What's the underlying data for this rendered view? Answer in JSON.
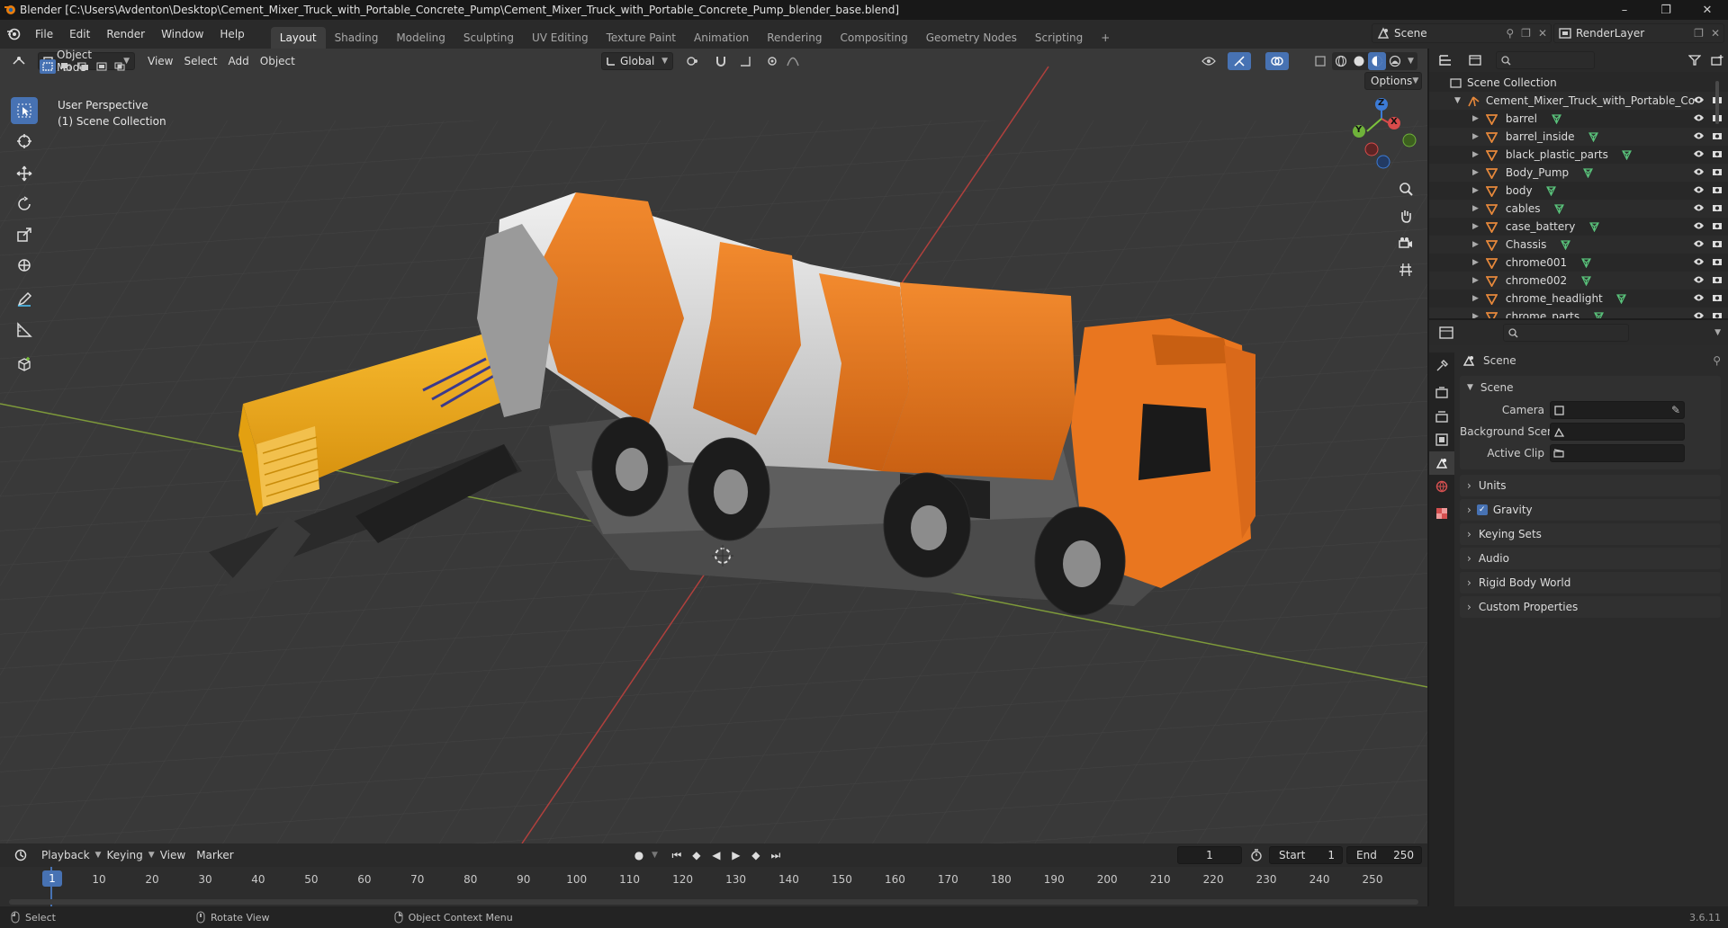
{
  "window": {
    "title": "Blender [C:\\Users\\Avdenton\\Desktop\\Cement_Mixer_Truck_with_Portable_Concrete_Pump\\Cement_Mixer_Truck_with_Portable_Concrete_Pump_blender_base.blend]",
    "controls": [
      "–",
      "❐",
      "✕"
    ]
  },
  "menu": [
    "File",
    "Edit",
    "Render",
    "Window",
    "Help"
  ],
  "workspaces": [
    "Layout",
    "Shading",
    "Modeling",
    "Sculpting",
    "UV Editing",
    "Texture Paint",
    "Animation",
    "Rendering",
    "Compositing",
    "Geometry Nodes",
    "Scripting"
  ],
  "add_workspace": "+",
  "scene_name": "Scene",
  "render_layer": "RenderLayer",
  "viewport": {
    "mode": "Object Mode",
    "menus": [
      "View",
      "Select",
      "Add",
      "Object"
    ],
    "orientation": "Global",
    "options_label": "Options",
    "perspective_label": "User Perspective",
    "collection_label": "(1) Scene Collection",
    "gizmo": {
      "x": "X",
      "y": "Y",
      "z": "Z"
    }
  },
  "outliner": {
    "root": "Scene Collection",
    "collection": "Cement_Mixer_Truck_with_Portable_Co",
    "items": [
      "barrel",
      "barrel_inside",
      "black_plastic_parts",
      "Body_Pump",
      "body",
      "cables",
      "case_battery",
      "Chassis",
      "chrome001",
      "chrome002",
      "chrome_headlight",
      "chrome_parts"
    ]
  },
  "properties": {
    "context": "Scene",
    "panel_title": "Scene",
    "fields": [
      {
        "label": "Camera",
        "value": ""
      },
      {
        "label": "Background Scene",
        "value": ""
      },
      {
        "label": "Active Clip",
        "value": ""
      }
    ],
    "collapsed": [
      "Units",
      "Gravity",
      "Keying Sets",
      "Audio",
      "Rigid Body World",
      "Custom Properties"
    ]
  },
  "timeline": {
    "menus": [
      "Playback",
      "Keying",
      "View",
      "Marker"
    ],
    "current_frame": "1",
    "start_label": "Start",
    "start": "1",
    "end_label": "End",
    "end": "250",
    "ticks": [
      "1",
      "10",
      "20",
      "30",
      "40",
      "50",
      "60",
      "70",
      "80",
      "90",
      "100",
      "110",
      "120",
      "130",
      "140",
      "150",
      "160",
      "170",
      "180",
      "190",
      "200",
      "210",
      "220",
      "230",
      "240",
      "250"
    ]
  },
  "status": {
    "select": "Select",
    "rotate": "Rotate View",
    "context_menu": "Object Context Menu",
    "version": "3.6.11"
  },
  "colors": {
    "accent": "#4772b3",
    "mesh_icon": "#e6883b",
    "mesh_data_icon": "#59c17a",
    "truck_orange": "#e9761f",
    "pump_yellow": "#f2a91a"
  }
}
